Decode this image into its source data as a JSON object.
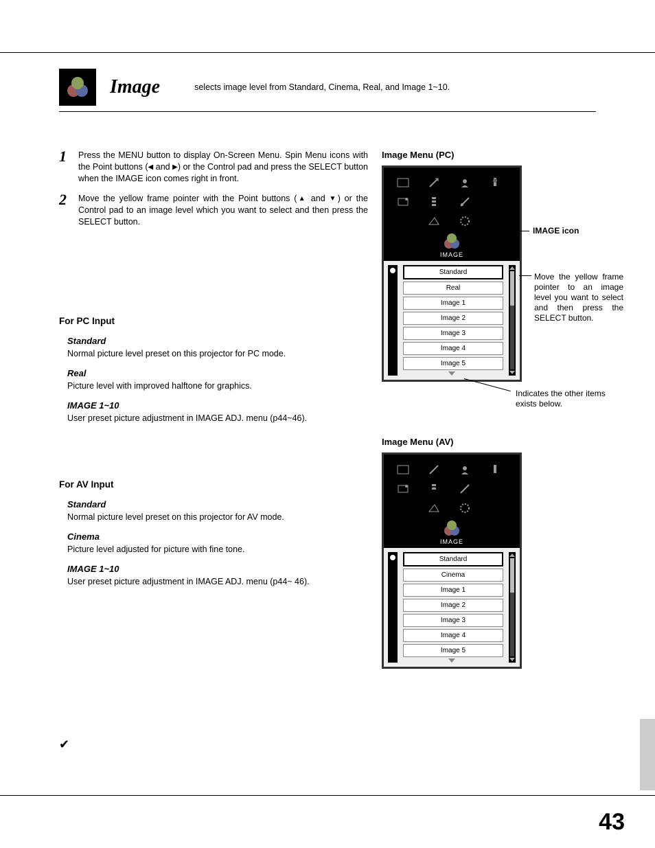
{
  "header": {
    "title": "Image",
    "desc": "selects image level from Standard, Cinema, Real, and Image 1~10."
  },
  "steps": [
    {
      "num": "1",
      "text_pre": "Press the MENU button to display On-Screen Menu. Spin Menu icons with the Point buttons (",
      "text_mid": " and ",
      "text_post": ") or the Control pad and press the SELECT button when the IMAGE icon comes right in front."
    },
    {
      "num": "2",
      "text_pre": "Move the yellow frame pointer with the Point buttons (",
      "text_mid": " and ",
      "text_post": ") or the Control pad to an image level which you want to select and then press the SELECT button."
    }
  ],
  "pc": {
    "heading": "For PC Input",
    "items": [
      {
        "title": "Standard",
        "desc": "Normal picture level preset on this projector for PC mode."
      },
      {
        "title": "Real",
        "desc": "Picture level with improved halftone for graphics."
      },
      {
        "title": "IMAGE 1~10",
        "desc": "User preset picture adjustment in IMAGE ADJ. menu (p44~46)."
      }
    ]
  },
  "av": {
    "heading": "For AV Input",
    "items": [
      {
        "title": "Standard",
        "desc": "Normal picture level preset on this projector for AV mode."
      },
      {
        "title": "Cinema",
        "desc": "Picture level adjusted for picture with fine tone."
      },
      {
        "title": "IMAGE 1~10",
        "desc": "User preset picture adjustment in IMAGE ADJ. menu (p44~ 46)."
      }
    ]
  },
  "right": {
    "pc_title": "Image Menu (PC)",
    "av_title": "Image Menu (AV)",
    "osd_label": "IMAGE",
    "pc_list": [
      "Standard",
      "Real",
      "Image 1",
      "Image 2",
      "Image 3",
      "Image 4",
      "Image 5"
    ],
    "av_list": [
      "Standard",
      "Cinema",
      "Image 1",
      "Image 2",
      "Image 3",
      "Image 4",
      "Image 5"
    ],
    "callout_icon": "IMAGE icon",
    "callout_move": "Move the yellow frame pointer to an image level you want to select and then press the SELECT button.",
    "callout_more": "Indicates the other items exists below."
  },
  "page_number": "43",
  "checkmark": "✔"
}
